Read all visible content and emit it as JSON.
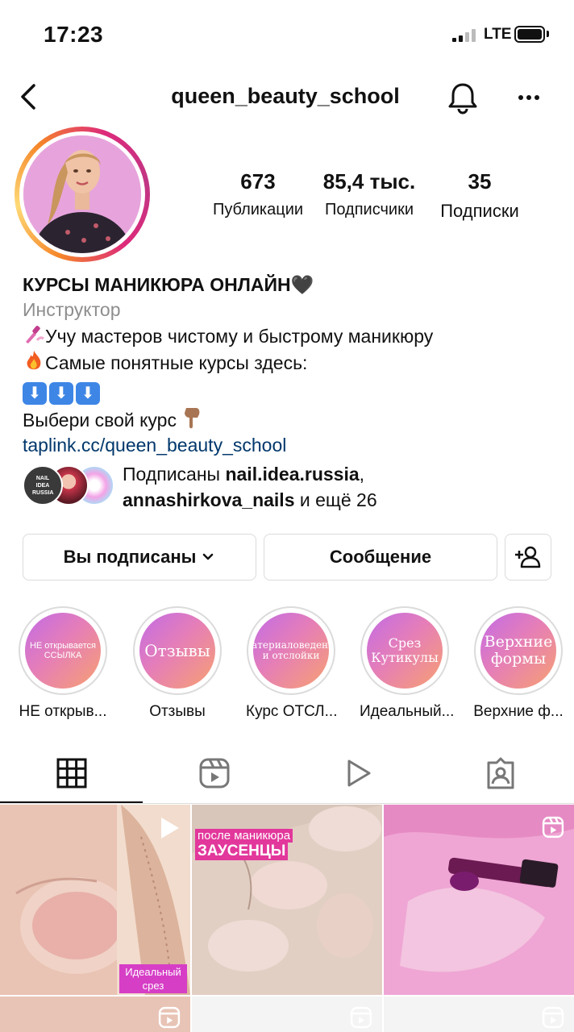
{
  "status_bar": {
    "time": "17:23",
    "network": "LTE"
  },
  "header": {
    "username": "queen_beauty_school"
  },
  "stats": [
    {
      "value": "673",
      "label": "Публикации"
    },
    {
      "value": "85,4 тыс.",
      "label": "Подписчики"
    },
    {
      "value": "35",
      "label": "Подписки"
    }
  ],
  "bio": {
    "name": "КУРСЫ МАНИКЮРА ОНЛАЙН🖤",
    "category": "Инструктор",
    "line1": "Учу мастеров чистому и быстрому маникюру",
    "line2": "Самые понятные курсы здесь:",
    "line3_arrows": [
      "⬇",
      "⬇",
      "⬇"
    ],
    "line4": "Выбери свой курс",
    "link": "taplink.cc/queen_beauty_school"
  },
  "followed_by": {
    "prefix": "Подписаны ",
    "user1": "nail.idea.russia",
    "sep": ",",
    "user2": "annashirkova_nails",
    "suffix": " и ещё 26",
    "avatar1_text": "NAIL IDEA RUSSIA"
  },
  "buttons": {
    "following": "Вы подписаны",
    "message": "Сообщение"
  },
  "highlights": [
    {
      "cover": "НЕ открывается ССЫЛКА",
      "label": "НЕ открыв..."
    },
    {
      "cover": "Отзывы",
      "label": "Отзывы"
    },
    {
      "cover": "Материаловедение и отслойки",
      "label": "Курс ОТСЛ..."
    },
    {
      "cover": "Срез Кутикулы",
      "label": "Идеальный..."
    },
    {
      "cover": "Верхние формы",
      "label": "Верхние ф..."
    }
  ],
  "grid": [
    {
      "caption": "Идеальный срез",
      "icon": "play-icon"
    },
    {
      "caption_top": "после маникюра",
      "caption_bottom": "ЗАУСЕНЦЫ",
      "icon": "none"
    },
    {
      "caption": "",
      "icon": "reels-icon"
    }
  ],
  "colors": {
    "link": "#00376b",
    "secondary_text": "#8e8e8e",
    "border": "#dbdbdb",
    "highlight_gradient": [
      "#c26be6",
      "#e57eb8",
      "#f7a071"
    ]
  }
}
